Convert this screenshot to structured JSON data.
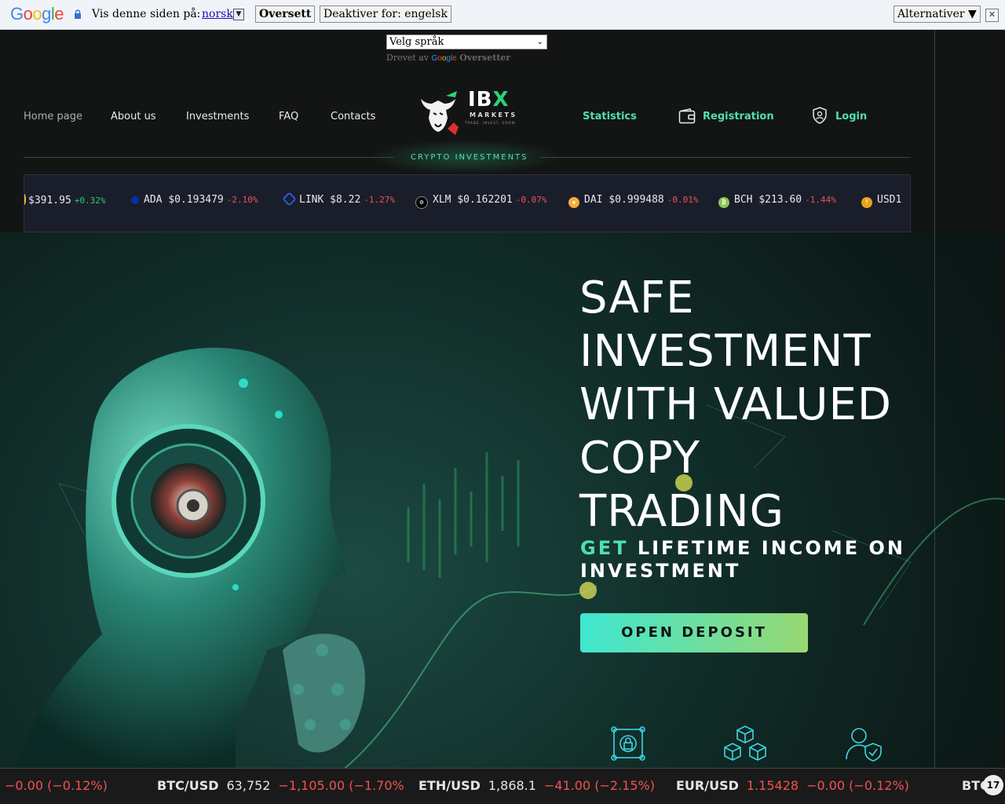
{
  "translate_bar": {
    "prompt": "Vis denne siden på:",
    "language": "norsk",
    "translate_button": "Oversett",
    "disable_button": "Deaktiver for: engelsk",
    "options_button": "Alternativer ▼",
    "close": "✕"
  },
  "language_widget": {
    "select_label": "Velg språk",
    "powered_by": "Drevet av",
    "powered_google": "Google",
    "powered_service": "Oversetter"
  },
  "nav": {
    "home": "Home page",
    "about": "About us",
    "investments": "Investments",
    "faq": "FAQ",
    "contacts": "Contacts",
    "statistics": "Statistics",
    "registration": "Registration",
    "login": "Login"
  },
  "brand": {
    "name_main": "IB",
    "name_accent": "X",
    "subtitle": "MARKETS",
    "tagline": "TRADE. INVEST. GROW.",
    "section_label": "CRYPTO INVESTMENTS"
  },
  "crypto_ticker": [
    {
      "symbol": "",
      "price": "$391.95",
      "change": "+0.32%",
      "direction": "up",
      "color": "#f3ba2f",
      "icon": ""
    },
    {
      "symbol": "ADA",
      "price": "$0.193479",
      "change": "-2.10%",
      "direction": "down",
      "color": "#0033ad",
      "icon": "ada-icon"
    },
    {
      "symbol": "LINK",
      "price": "$8.22",
      "change": "-1.27%",
      "direction": "down",
      "color": "#2a5ada",
      "icon": "link-icon"
    },
    {
      "symbol": "XLM",
      "price": "$0.162201",
      "change": "-0.07%",
      "direction": "down",
      "color": "#222222",
      "icon": "xlm-icon"
    },
    {
      "symbol": "DAI",
      "price": "$0.999488",
      "change": "-0.01%",
      "direction": "down",
      "color": "#f5ac37",
      "icon": "dai-icon"
    },
    {
      "symbol": "BCH",
      "price": "$213.60",
      "change": "-1.44%",
      "direction": "down",
      "color": "#8dc351",
      "icon": "bch-icon"
    },
    {
      "symbol": "USD1",
      "price": "",
      "change": "",
      "direction": "",
      "color": "#e8a317",
      "icon": "usd1-icon"
    }
  ],
  "hero": {
    "title_lines": [
      "SAFE",
      "INVESTMENT",
      "WITH VALUED",
      "COPY",
      "TRADING"
    ],
    "subtitle_accent": "GET",
    "subtitle_rest": "LIFETIME INCOME ON",
    "subtitle_line2": "INVESTMENT",
    "cta": "OPEN DEPOSIT"
  },
  "bottom_ticker": [
    {
      "symbol": "",
      "price": "",
      "change": "−0.00 (−0.12%)"
    },
    {
      "symbol": "BTC/USD",
      "price": "63,752",
      "change": "−1,105.00 (−1.70%"
    },
    {
      "symbol": "ETH/USD",
      "price": "1,868.1",
      "change": "−41.00 (−2.15%)"
    },
    {
      "symbol": "EUR/USD",
      "price": "1.15428",
      "change": "−0.00 (−0.12%)",
      "price_red": true
    },
    {
      "symbol": "BTC",
      "price": "",
      "change": ""
    }
  ],
  "widget_badge": "17",
  "colors": {
    "accent": "#4fe0b0",
    "negative": "#ef5350",
    "positive": "#2ecc71",
    "cta_start": "#3fe6d0",
    "cta_end": "#98d873"
  }
}
